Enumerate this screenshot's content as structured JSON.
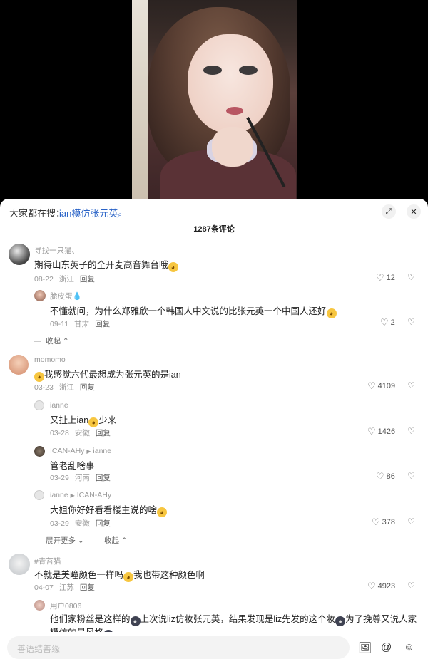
{
  "trending": {
    "prefix": "大家都在搜：",
    "query": "ian模仿张元英",
    "search_glyph": "⌕"
  },
  "header": {
    "title": "1287条评论",
    "expand_glyph": "⤢",
    "close_glyph": "✕"
  },
  "comments": [
    {
      "user": "寻找一只猫、",
      "text_a": "期待山东英子的全开麦高音舞台哦",
      "emoji_a": "😂",
      "date": "08-22",
      "loc": "浙江",
      "reply": "回复",
      "likes": "12"
    },
    {
      "user": "脆皮蛋💧",
      "text_a": "不懂就问，为什么郑雅欣一个韩国人中文说的比张元英一个中国人还好",
      "emoji_a": "😭",
      "date": "09-11",
      "loc": "甘肃",
      "reply": "回复",
      "likes": "2"
    },
    {
      "collapse": "收起"
    },
    {
      "user": "momomo",
      "emoji_pre": "🥺",
      "text_a": "我感觉六代最想成为张元英的是ian",
      "date": "03-23",
      "loc": "浙江",
      "reply": "回复",
      "likes": "4109"
    },
    {
      "user": "ianne",
      "text_a": "又扯上ian",
      "emoji_a": "😂",
      "text_b": "少来",
      "date": "03-28",
      "loc": "安徽",
      "reply": "回复",
      "likes": "1426"
    },
    {
      "user": "ICAN-AHy",
      "reply_to": "ianne",
      "text_a": "管老乱啥事",
      "date": "03-29",
      "loc": "河南",
      "reply": "回复",
      "likes": "86"
    },
    {
      "user": "ianne",
      "reply_to": "ICAN-AHy",
      "text_a": "大姐你好好看看楼主说的啥",
      "emoji_a": "🥺",
      "date": "03-29",
      "loc": "安徽",
      "reply": "回复",
      "likes": "378"
    },
    {
      "expand": "展开更多",
      "collapse": "收起"
    },
    {
      "user": "#青苔猫",
      "text_a": "不就是美瞳颜色一样吗",
      "emoji_a": "🥺",
      "text_b": "我也带这种颜色啊",
      "date": "04-07",
      "loc": "江苏",
      "reply": "回复",
      "likes": "4923"
    },
    {
      "user": "用户0806",
      "text_a": "他们家粉丝是这样的",
      "text_b": "上次说liz仿妆张元英，结果发现是liz先发的这个妆",
      "text_c": "为了挽尊又说人家模仿",
      "text_d": "的是风格"
    }
  ],
  "input": {
    "placeholder": "善语结善缘"
  },
  "icons": {
    "heart": "♡",
    "dislike": "♡",
    "chevron_down": "⌄",
    "chevron_up": "⌃",
    "image": "🖼",
    "at": "@",
    "emoji": "☺"
  }
}
